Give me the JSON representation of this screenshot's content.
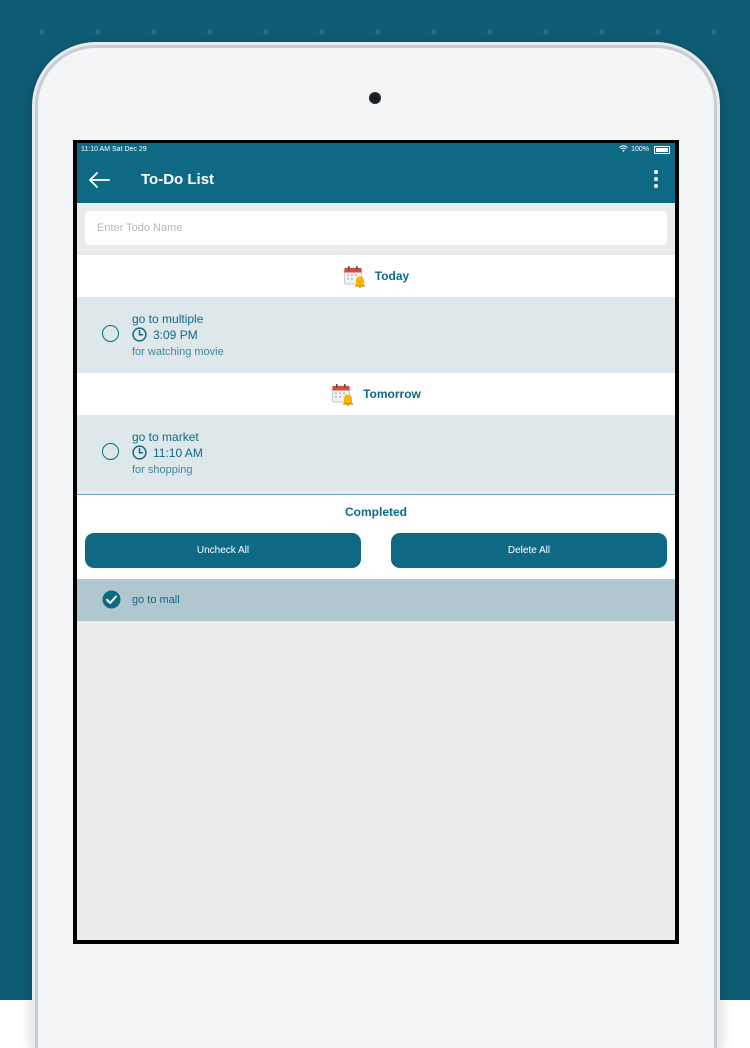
{
  "status_bar": {
    "time_date": "11:10 AM   Sat Dec 29",
    "battery": "100%"
  },
  "app_bar": {
    "title": "To-Do List",
    "back_icon": "back-arrow-icon",
    "menu_icon": "more-vertical-icon"
  },
  "search": {
    "placeholder": "Enter Todo Name",
    "value": ""
  },
  "sections": [
    {
      "label": "Today",
      "icon": "calendar-bell-icon",
      "items": [
        {
          "name": "go to multiple",
          "time": "3:09 PM",
          "description": "for watching movie",
          "checked": false
        }
      ]
    },
    {
      "label": "Tomorrow",
      "icon": "calendar-bell-icon",
      "items": [
        {
          "name": "go to market",
          "time": "11:10 AM",
          "description": "for shopping",
          "checked": false
        }
      ]
    }
  ],
  "completed": {
    "title": "Completed",
    "uncheck_all_label": "Uncheck All",
    "delete_all_label": "Delete All",
    "items": [
      {
        "name": "go to mall",
        "checked": true
      }
    ]
  },
  "colors": {
    "primary": "#0e6a84",
    "background": "#0e5b74",
    "item_bg": "#dee7ea",
    "completed_item_bg": "#b1c7cf"
  }
}
